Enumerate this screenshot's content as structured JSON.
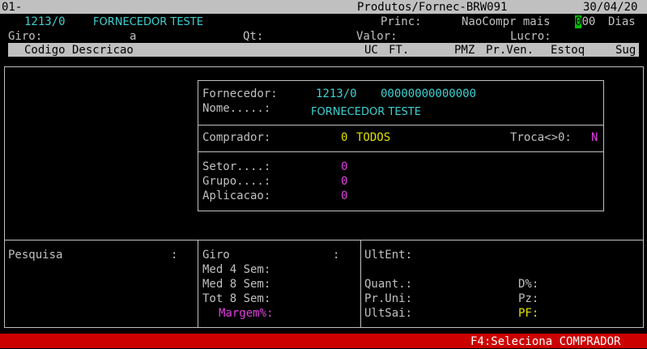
{
  "titlebar": {
    "left": "01-",
    "center": "Produtos/Fornec-BRW091",
    "date": "30/04/20"
  },
  "header": {
    "code": "1213/0",
    "name": "FORNECEDOR TESTE",
    "princ_label": "Princ:",
    "naocompr_label": "NaoCompr mais",
    "naocompr_cursor": "0",
    "naocompr_value": "00",
    "dias_label": "Dias",
    "giro_label": "Giro:",
    "giro_value": "a",
    "qt_label": "Qt:",
    "valor_label": "Valor:",
    "lucro_label": "Lucro:"
  },
  "columns": {
    "left": "Codigo Descricao",
    "uc": "UC",
    "ft": "FT.",
    "pmz": "PMZ",
    "prven": "Pr.Ven.",
    "estoq": "Estoq",
    "sug": "Sug"
  },
  "dialog": {
    "fornecedor_label": "Fornecedor:",
    "fornecedor_code": "1213/0",
    "fornecedor_doc": "00000000000000",
    "nome_label": "Nome.....:",
    "nome_value": "FORNECEDOR TESTE",
    "comprador_label": "Comprador:",
    "comprador_code": "0",
    "comprador_name": "TODOS",
    "troca_label": "Troca<>0:",
    "troca_value": "N",
    "setor_label": "Setor....:",
    "setor_value": "0",
    "grupo_label": "Grupo....:",
    "grupo_value": "0",
    "aplicacao_label": "Aplicacao:",
    "aplicacao_value": "0"
  },
  "bottom": {
    "pesquisa_label": "Pesquisa",
    "pesquisa_colon": ":",
    "giro_label": "Giro",
    "giro_colon": ":",
    "med4_label": "Med 4 Sem:",
    "med8_label": "Med 8 Sem:",
    "tot8_label": "Tot 8 Sem:",
    "margem_label": "Margem%:",
    "ultent_label": "UltEnt:",
    "quant_label": "Quant.:",
    "pruni_label": "Pr.Uni:",
    "ultsai_label": "UltSai:",
    "dperc_label": "D%:",
    "pz_label": "Pz:",
    "pf_label": "PF:"
  },
  "statusbar": {
    "hint": "F4:Seleciona COMPRADOR"
  }
}
